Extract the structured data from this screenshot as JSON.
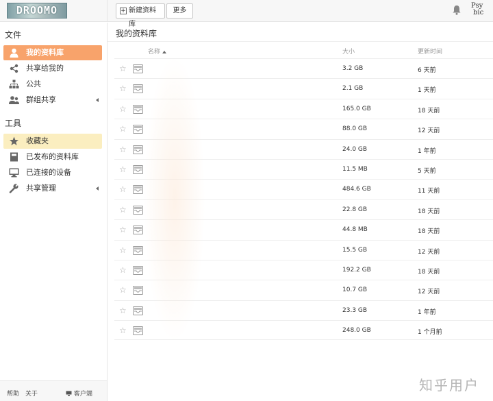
{
  "header": {
    "logo_text": "DROOMO",
    "new_library_label": "新建资料库",
    "more_label": "更多",
    "avatar_line1": "Psy",
    "avatar_line2": "bic"
  },
  "sidebar": {
    "files_title": "文件",
    "files_items": [
      {
        "label": "我的资料库",
        "icon": "user-icon"
      },
      {
        "label": "共享给我的",
        "icon": "share-icon"
      },
      {
        "label": "公共",
        "icon": "org-tree-icon"
      },
      {
        "label": "群组共享",
        "icon": "group-icon"
      }
    ],
    "tools_title": "工具",
    "tools_items": [
      {
        "label": "收藏夹",
        "icon": "star-icon"
      },
      {
        "label": "已发布的资料库",
        "icon": "book-icon"
      },
      {
        "label": "已连接的设备",
        "icon": "monitor-icon"
      },
      {
        "label": "共享管理",
        "icon": "wrench-icon"
      }
    ],
    "footer": {
      "help": "帮助",
      "about": "关于",
      "client": "客户端"
    }
  },
  "main": {
    "title": "我的资料库",
    "columns": {
      "name": "名称",
      "size": "大小",
      "updated": "更新时间"
    },
    "rows": [
      {
        "size": "3.2 GB",
        "time": "6 天前"
      },
      {
        "size": "2.1 GB",
        "time": "1 天前"
      },
      {
        "size": "165.0 GB",
        "time": "18 天前"
      },
      {
        "size": "88.0 GB",
        "time": "12 天前"
      },
      {
        "size": "24.0 GB",
        "time": "1 年前"
      },
      {
        "size": "11.5 MB",
        "time": "5 天前"
      },
      {
        "size": "484.6 GB",
        "time": "11 天前"
      },
      {
        "size": "22.8 GB",
        "time": "18 天前"
      },
      {
        "size": "44.8 MB",
        "time": "18 天前"
      },
      {
        "size": "15.5 GB",
        "time": "12 天前"
      },
      {
        "size": "192.2 GB",
        "time": "18 天前"
      },
      {
        "size": "10.7 GB",
        "time": "12 天前"
      },
      {
        "size": "23.3 GB",
        "time": "1 年前"
      },
      {
        "size": "248.0 GB",
        "time": "1 个月前"
      }
    ]
  },
  "watermark": "知乎用户",
  "colors": {
    "active_item": "#f8a36b",
    "favorite_item": "#fbeec0"
  }
}
